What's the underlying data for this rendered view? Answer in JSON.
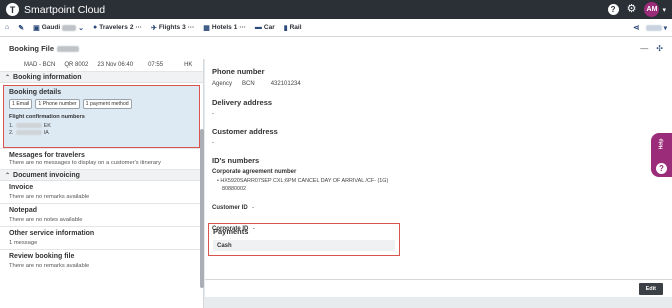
{
  "app": {
    "title": "Smartpoint Cloud",
    "logo_letter": "T",
    "help": "?",
    "avatar": "AM"
  },
  "nav": {
    "home": "⌂",
    "tool": "🔧",
    "gaudi": "Gaudi",
    "travelers": "Travelers",
    "travelers_count": "2",
    "flights": "Flights",
    "flights_count": "3",
    "hotels": "Hotels",
    "hotels_count": "1",
    "car": "Car",
    "rail": "Rail",
    "more": "···"
  },
  "booking_file": {
    "title": "Booking File"
  },
  "flight_summary": {
    "route": "MAD - BCN",
    "flight": "QR 8002",
    "date": "23 Nov 06:40",
    "time": "07:55",
    "status": "HK"
  },
  "left_panel": {
    "booking_information_label": "Booking information",
    "booking_details": {
      "title": "Booking details",
      "chips": [
        "1 Email",
        "1 Phone number",
        "1 payment method"
      ],
      "flight_conf_title": "Flight confirmation numbers",
      "lines": [
        {
          "num": "1.",
          "code": "EK"
        },
        {
          "num": "2.",
          "code": "IA"
        }
      ]
    },
    "messages": {
      "title": "Messages for travelers",
      "sub": "There are no messages to display on a customer's itinerary"
    },
    "document_invoicing_label": "Document invoicing",
    "invoice": {
      "title": "Invoice",
      "sub": "There are no remarks available"
    },
    "notepad": {
      "title": "Notepad",
      "sub": "There are no notes available"
    },
    "osi": {
      "title": "Other service information",
      "sub": "1 message"
    },
    "review": {
      "title": "Review booking file",
      "sub": "There are no remarks available"
    }
  },
  "right_panel": {
    "phone": {
      "title": "Phone number",
      "type": "Agency",
      "city": "BCN",
      "number": "432101234"
    },
    "delivery": {
      "title": "Delivery address",
      "value": "-"
    },
    "customer": {
      "title": "Customer address",
      "value": "-"
    },
    "ids": {
      "title": "ID's numbers",
      "corp_label": "Corporate agreement number",
      "corp_line": "• HX5920SARR07SEP CXL:6PM CANCEL DAY OF ARRIVAL /CF-   (1G)",
      "corp_num": "80880002",
      "customer_id": "Customer ID",
      "customer_id_val": "-",
      "corporate_id": "Corporate ID",
      "corporate_id_val": "-"
    },
    "payments": {
      "title": "Payments",
      "method": "Cash"
    }
  },
  "help_tab": {
    "label": "Help",
    "icon": "?"
  },
  "actions": {
    "edit": "Edit"
  }
}
